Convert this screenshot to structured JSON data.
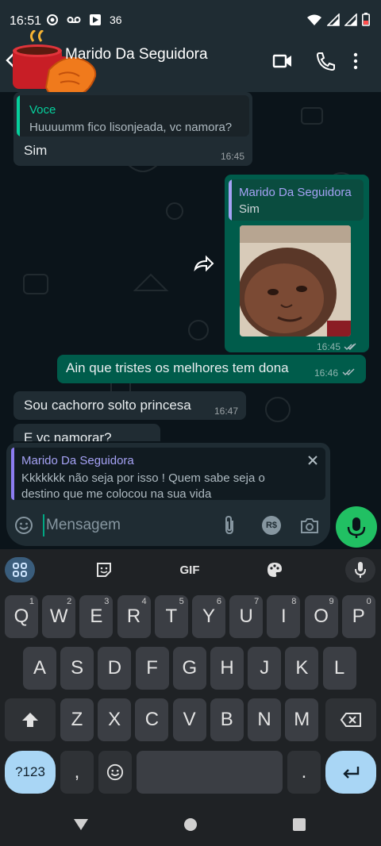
{
  "status_bar": {
    "time": "16:51",
    "network_label": "36"
  },
  "header": {
    "title": "Marido Da Seguidora"
  },
  "messages": [
    {
      "type": "in",
      "quote_name": "Voce",
      "quote_text": "Huuuumm fico lisonjeada, vc namora?",
      "text": "Sim",
      "time": "16:45"
    },
    {
      "type": "out",
      "quote_name": "Marido Da Seguidora",
      "quote_text": "Sim",
      "time": "16:45",
      "has_image": true
    },
    {
      "type": "out",
      "text": "Ain que tristes os melhores tem dona",
      "time": "16:46"
    },
    {
      "type": "in",
      "text": "Sou cachorro solto princesa",
      "time": "16:47"
    },
    {
      "type": "in",
      "text": "E vc namorar?"
    }
  ],
  "reply_preview": {
    "name": "Marido Da Seguidora",
    "text": "Kkkkkkk não seja por isso ! Quem sabe seja o destino que me colocou na sua vida"
  },
  "composer": {
    "placeholder": "Mensagem",
    "currency_label": "R$"
  },
  "keyboard": {
    "toolbar": {
      "gif_label": "GIF"
    },
    "row1": [
      {
        "key": "Q",
        "hint": "1"
      },
      {
        "key": "W",
        "hint": "2"
      },
      {
        "key": "E",
        "hint": "3"
      },
      {
        "key": "R",
        "hint": "4"
      },
      {
        "key": "T",
        "hint": "5"
      },
      {
        "key": "Y",
        "hint": "6"
      },
      {
        "key": "U",
        "hint": "7"
      },
      {
        "key": "I",
        "hint": "8"
      },
      {
        "key": "O",
        "hint": "9"
      },
      {
        "key": "P",
        "hint": "0"
      }
    ],
    "row2": [
      "A",
      "S",
      "D",
      "F",
      "G",
      "H",
      "J",
      "K",
      "L"
    ],
    "row3": [
      "Z",
      "X",
      "C",
      "V",
      "B",
      "N",
      "M"
    ],
    "symbols_label": "?123",
    "comma": ",",
    "period": "."
  },
  "colors": {
    "accent": "#00a884",
    "outgoing": "#005c4b",
    "incoming": "#202c33",
    "mic": "#21c063",
    "quote_name": "#a5a2f5"
  }
}
